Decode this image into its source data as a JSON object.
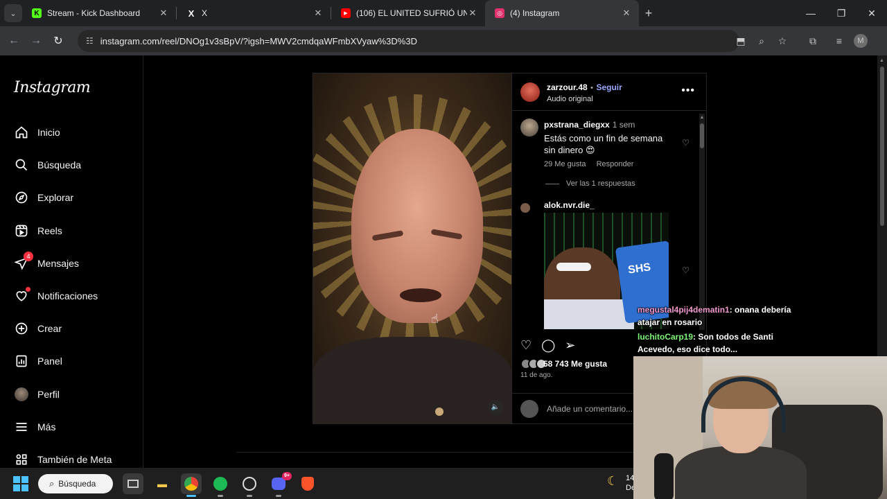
{
  "browser": {
    "tabs": [
      {
        "title": "Stream - Kick Dashboard",
        "favicon": "K",
        "favicon_color": "#53fc18"
      },
      {
        "title": "X",
        "favicon": "X",
        "favicon_color": "#ffffff"
      },
      {
        "title": "(106) EL UNITED SUFRIÓ UN BA",
        "favicon": "▶",
        "favicon_color": "#ff0000"
      },
      {
        "title": "(4) Instagram",
        "favicon": "◎",
        "favicon_color": "#e1306c"
      }
    ],
    "url": "instagram.com/reel/DNOg1v3sBpV/?igsh=MWV2cmdqaWFmbXVyaw%3D%3D",
    "profile_initial": "M"
  },
  "sidebar": {
    "logo": "Instagram",
    "items": [
      {
        "label": "Inicio",
        "icon": "home-icon"
      },
      {
        "label": "Búsqueda",
        "icon": "search-icon"
      },
      {
        "label": "Explorar",
        "icon": "compass-icon"
      },
      {
        "label": "Reels",
        "icon": "reels-icon"
      },
      {
        "label": "Mensajes",
        "icon": "messenger-icon",
        "badge": "4"
      },
      {
        "label": "Notificaciones",
        "icon": "heart-icon"
      },
      {
        "label": "Crear",
        "icon": "plus-square-icon"
      },
      {
        "label": "Panel",
        "icon": "dashboard-icon"
      },
      {
        "label": "Perfil",
        "icon": "profile-avatar"
      },
      {
        "label": "Más",
        "icon": "menu-icon"
      },
      {
        "label": "También de Meta",
        "icon": "apps-icon"
      }
    ]
  },
  "post": {
    "author": "zarzour.48",
    "follow_label": "Seguir",
    "separator": "•",
    "audio": "Audio original",
    "more_label": "•••",
    "comments": [
      {
        "user": "pxstrana_diegxx",
        "time": "1 sem",
        "text": "Estás como un fin de semana sin dinero 😍",
        "likes": "29 Me gusta",
        "reply_label": "Responder"
      },
      {
        "user": "alok.nvr.die_",
        "gif_label": "SHS"
      }
    ],
    "view_replies": "Ver las 1 respuestas",
    "likes_count": "58 743 Me gusta",
    "date": "11 de ago.",
    "comment_placeholder": "Añade un comentario..."
  },
  "chat": [
    {
      "name": "megustal4pij4dematin1",
      "text": ": onana debería atajar en rosario"
    },
    {
      "name": "luchitoCarp19",
      "text": ": Son todos de Santi Acevedo, eso dice todo..."
    }
  ],
  "taskbar": {
    "search_label": "Búsqueda",
    "discord_badge": "9+",
    "clock_line1": "14",
    "clock_line2": "De"
  }
}
